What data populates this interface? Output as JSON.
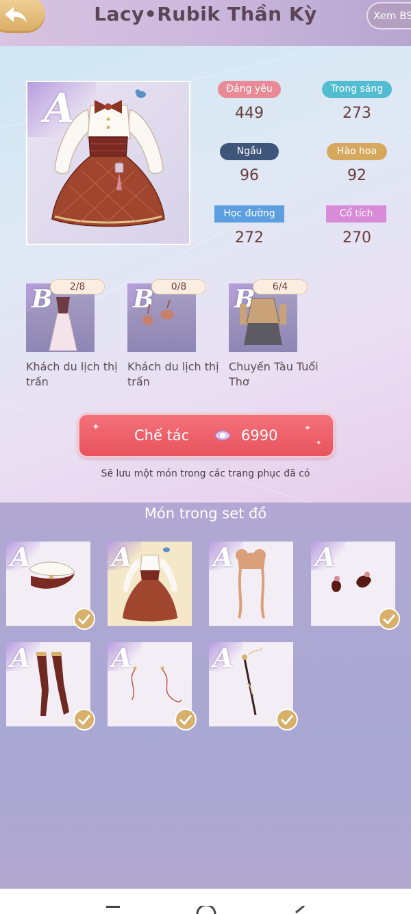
{
  "header": {
    "title": "Lacy•Rubik Thần Kỳ",
    "view_label": "Xem BS"
  },
  "outfit": {
    "rank": "A",
    "stats": [
      {
        "label": "Đáng yêu",
        "value": "449",
        "color": "#e98a96"
      },
      {
        "label": "Trong sáng",
        "value": "273",
        "color": "#52bcd0"
      },
      {
        "label": "Ngầu",
        "value": "96",
        "color": "#3f557a"
      },
      {
        "label": "Hào hoa",
        "value": "92",
        "color": "#d6a85e"
      },
      {
        "label": "Học đường",
        "value": "272",
        "color": "#5c9ee0"
      },
      {
        "label": "Cổ tích",
        "value": "270",
        "color": "#d98ad8"
      }
    ]
  },
  "materials": [
    {
      "rank": "B",
      "count": "2/8",
      "name": "Khách du lịch thị trấn"
    },
    {
      "rank": "B",
      "count": "0/8",
      "name": "Khách du lịch thị trấn"
    },
    {
      "rank": "B",
      "count": "6/4",
      "name": "Chuyến Tàu Tuổi Thơ"
    }
  ],
  "craft": {
    "label": "Chế tác",
    "cost": "6990",
    "note": "Sẽ lưu một món trong các trang phục đã có"
  },
  "set": {
    "title": "Món trong set đồ",
    "items": [
      {
        "rank": "A",
        "name": "hat",
        "owned": true
      },
      {
        "rank": "A",
        "name": "dress",
        "owned": false,
        "selected": true
      },
      {
        "rank": "A",
        "name": "hair",
        "owned": false
      },
      {
        "rank": "A",
        "name": "shoes",
        "owned": true
      },
      {
        "rank": "A",
        "name": "stockings",
        "owned": true
      },
      {
        "rank": "A",
        "name": "earrings",
        "owned": true
      },
      {
        "rank": "A",
        "name": "wand",
        "owned": true
      }
    ]
  },
  "colors": {
    "accent": "#e8535e",
    "gold": "#d7b06c",
    "text_dark": "#6b3c3c"
  }
}
